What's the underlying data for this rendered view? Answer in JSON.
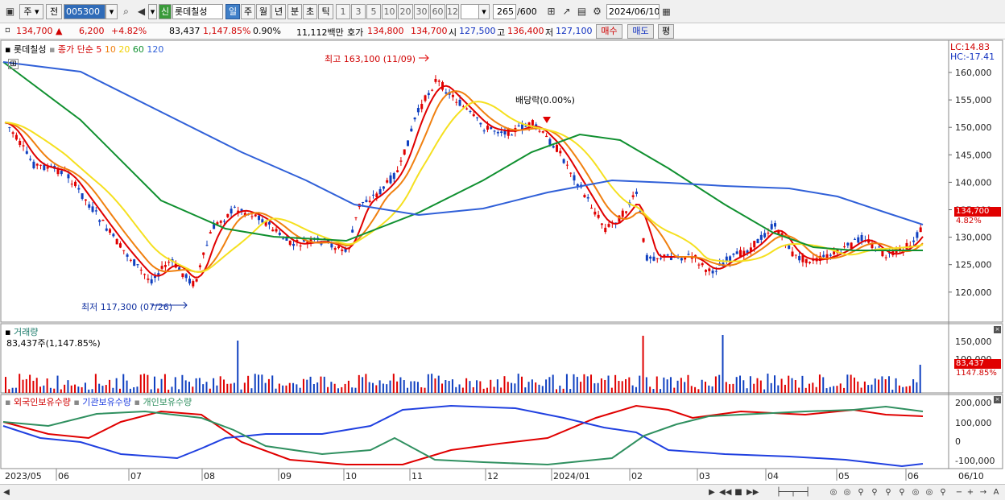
{
  "toolbar": {
    "market": "주",
    "prev": "전",
    "code": "005300",
    "stock_name": "롯데칠성",
    "stock_tag": "신",
    "periods": [
      "일",
      "주",
      "월",
      "년",
      "분",
      "초",
      "틱"
    ],
    "intervals": [
      "1",
      "3",
      "5",
      "10",
      "20",
      "30",
      "60",
      "120"
    ],
    "count": "265",
    "total": "/600",
    "date": "2024/06/10"
  },
  "quote": {
    "price": "134,700",
    "change": "6,200",
    "change_pct": "+4.82%",
    "volume": "83,437",
    "volume_pct": "1,147.85%",
    "turnover_rate": "0.90%",
    "amount": "11,112백만",
    "ask_label": "호가",
    "ask": "134,800",
    "bid": "134,700",
    "open_label": "시",
    "open": "127,500",
    "high_label": "고",
    "high": "136,400",
    "low_label": "저",
    "low": "127,100",
    "buy_label": "매수",
    "sell_label": "매도",
    "eval_label": "평"
  },
  "price_panel": {
    "name": "롯데칠성",
    "ma_title": "종가 단순",
    "ma_periods": [
      "5",
      "10",
      "20",
      "60",
      "120"
    ],
    "lc": "LC:14.83",
    "hc": "HC:-17.41",
    "high_note": "최고 163,100 (11/09)",
    "low_note": "최저 117,300 (07/26)",
    "dividend_note": "배당락(0.00%)",
    "last_price": "134,700",
    "last_pct": "4.82%",
    "y_labels": [
      "160,000",
      "155,000",
      "150,000",
      "145,000",
      "140,000",
      "135,000",
      "130,000",
      "125,000",
      "120,000"
    ]
  },
  "volume_panel": {
    "title": "거래량",
    "value_line": "83,437주(1,147.85%)",
    "y_labels": [
      "150,000",
      "100,000"
    ],
    "last_value": "83,437",
    "last_pct": "1147.85%"
  },
  "holding_panel": {
    "series": [
      "외국인보유수량",
      "기관보유수량",
      "개인보유수량"
    ],
    "y_labels": [
      "200,000",
      "100,000",
      "0",
      "-100,000"
    ]
  },
  "x_labels": [
    "2023/05",
    "06",
    "07",
    "08",
    "09",
    "10",
    "11",
    "12",
    "2024/01",
    "02",
    "03",
    "04",
    "05",
    "06",
    "06/10"
  ],
  "colors": {
    "ma5": "#e00000",
    "ma10": "#f08010",
    "ma20": "#f5e020",
    "ma60": "#109030",
    "ma120": "#3060d8",
    "up": "#e00000",
    "down": "#1040c0",
    "foreign": "#e00000",
    "institution": "#2040e0",
    "individual": "#309060"
  }
}
